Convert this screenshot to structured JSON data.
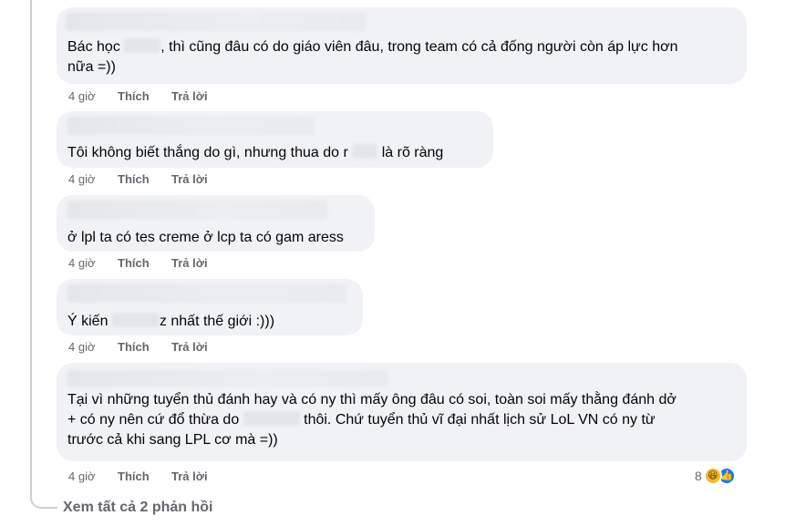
{
  "actions": {
    "time": "4 giờ",
    "like": "Thích",
    "reply": "Trả lời"
  },
  "comments": [
    {
      "text_before": "Bác học",
      "text_after": ", thì cũng đâu có do giáo viên đâu, trong team có cả đống người còn áp lực hơn",
      "text_line2": "nữa =))"
    },
    {
      "text_before": "Tôi không biết thắng do gì, nhưng thua do r",
      "text_after": "là rõ ràng"
    },
    {
      "text": "ở lpl ta có tes creme ở lcp ta có gam aress"
    },
    {
      "text_before": "Ý kiến",
      "text_after": "z nhất thế giới :)))"
    },
    {
      "line1": "Tại vì những tuyển thủ đánh hay và có ny thì mấy ông đâu có soi, toàn soi mấy thằng đánh dở",
      "line2_before": "+ có ny nên cứ đổ thừa do",
      "line2_after": "thôi. Chứ tuyển thủ vĩ đại nhất lịch sử LoL VN có ny từ",
      "line3": "trước cả khi sang LPL cơ mà =))",
      "reaction_count": "8"
    }
  ],
  "see_more": "Xem tất cả 2 phản hồi"
}
